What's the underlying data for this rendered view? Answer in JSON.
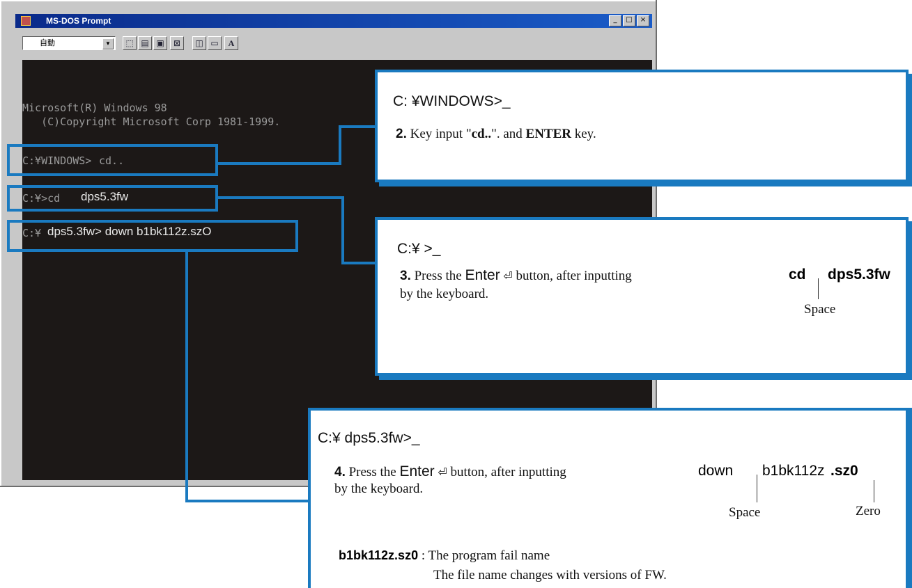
{
  "window": {
    "title": "MS-DOS Prompt",
    "font_select_value": "自動",
    "toolbar_font_button": "A",
    "buttons": {
      "minimize": "_",
      "maximize": "□",
      "close": "×"
    }
  },
  "console": {
    "line1": "Microsoft(R) Windows 98",
    "line2": "   (C)Copyright Microsoft Corp 1981-1999.",
    "cmd1_prefix": "C:¥WINDOWS>",
    "cmd1_input": "cd..",
    "cmd2_prefix": "C:¥>cd",
    "cmd2_input": "dps5.3fw",
    "cmd3_prefix": "C:¥",
    "cmd3_input": "dps5.3fw> down b1bk112z.szO"
  },
  "step2": {
    "prompt": "C: ¥WINDOWS>_",
    "num": "2.",
    "t1": " Key input \"",
    "cmd": "cd..",
    "t2": "\". and ",
    "key": "ENTER",
    "t3": " key."
  },
  "step3": {
    "prompt": "C:¥ >_",
    "num": "3.",
    "t1": " Press the ",
    "enter": "Enter",
    "enter_symbol": "⏎",
    "t2": " button, after inputting ",
    "cmd_a": "cd",
    "cmd_b": "dps5.3fw",
    "t3": "by the keyboard.",
    "space": "Space"
  },
  "step4": {
    "prompt": "C:¥ dps5.3fw>_",
    "num": "4.",
    "t1": " Press the ",
    "enter": "Enter",
    "enter_symbol": "⏎",
    "t2": " button, after inputting ",
    "cmd_a": "down",
    "cmd_b": "b1bk112z",
    "cmd_c": ".sz0",
    "t3": "by the keyboard.",
    "space": "Space",
    "zero": "Zero",
    "file": "b1bk112z.sz0",
    "file_desc1": " : The program fail name",
    "file_desc2": "The file name changes with versions of FW."
  },
  "colors": {
    "accent": "#1a7ac0",
    "console_bg": "#1c1817",
    "titlebar": "#0a2a8a"
  }
}
